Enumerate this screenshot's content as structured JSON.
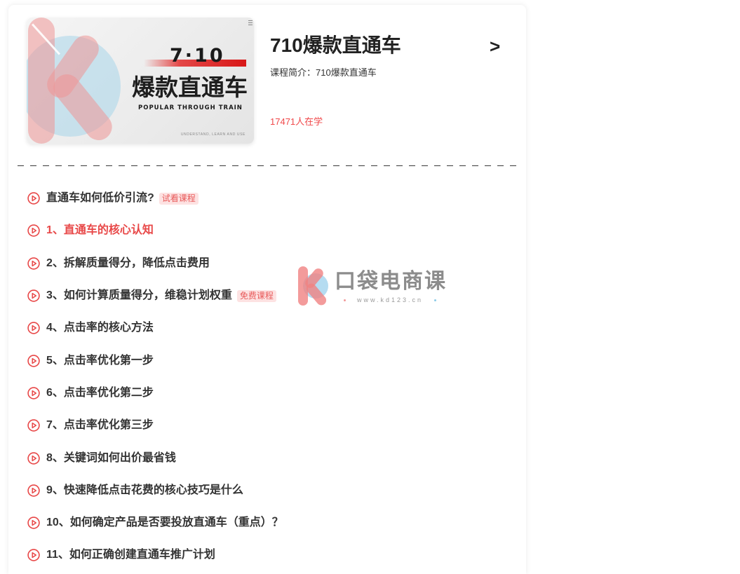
{
  "course": {
    "title": "710爆款直通车",
    "arrow": ">",
    "intro": "课程简介：710爆款直通车",
    "learners": "17471人在学",
    "cover": {
      "number": "7·10",
      "title": "爆款直通车",
      "subtitle": "POPULAR THROUGH TRAIN",
      "footer": "UNDERSTAND, LEARN AND USE"
    }
  },
  "lessons": [
    {
      "title": "直通车如何低价引流?",
      "badge": "试看课程",
      "active": false
    },
    {
      "title": "1、直通车的核心认知",
      "active": true
    },
    {
      "title": "2、拆解质量得分，降低点击费用",
      "active": false
    },
    {
      "title": "3、如何计算质量得分，维稳计划权重",
      "badge": "免费课程",
      "active": false
    },
    {
      "title": "4、点击率的核心方法",
      "active": false
    },
    {
      "title": "5、点击率优化第一步",
      "active": false
    },
    {
      "title": "6、点击率优化第二步",
      "active": false
    },
    {
      "title": "7、点击率优化第三步",
      "active": false
    },
    {
      "title": "8、关键词如何出价最省钱",
      "active": false
    },
    {
      "title": "9、快速降低点击花费的核心技巧是什么",
      "active": false
    },
    {
      "title": "10、如何确定产品是否要投放直通车（重点）？",
      "active": false
    },
    {
      "title": "11、如何正确创建直通车推广计划",
      "active": false
    }
  ],
  "watermark": {
    "brand": "口袋电商课",
    "url": "www.kd123.cn"
  },
  "icons": {
    "lesson": "play-circle-icon",
    "header_arrow": "chevron-right-icon",
    "watermark_logo": "k-logo-icon"
  },
  "colors": {
    "accent": "#e84848",
    "badge_bg": "#fde2e2",
    "badge_text": "#e85a5a",
    "text": "#333333",
    "logo_pink": "#f08282",
    "logo_blue": "#96cdeb"
  }
}
